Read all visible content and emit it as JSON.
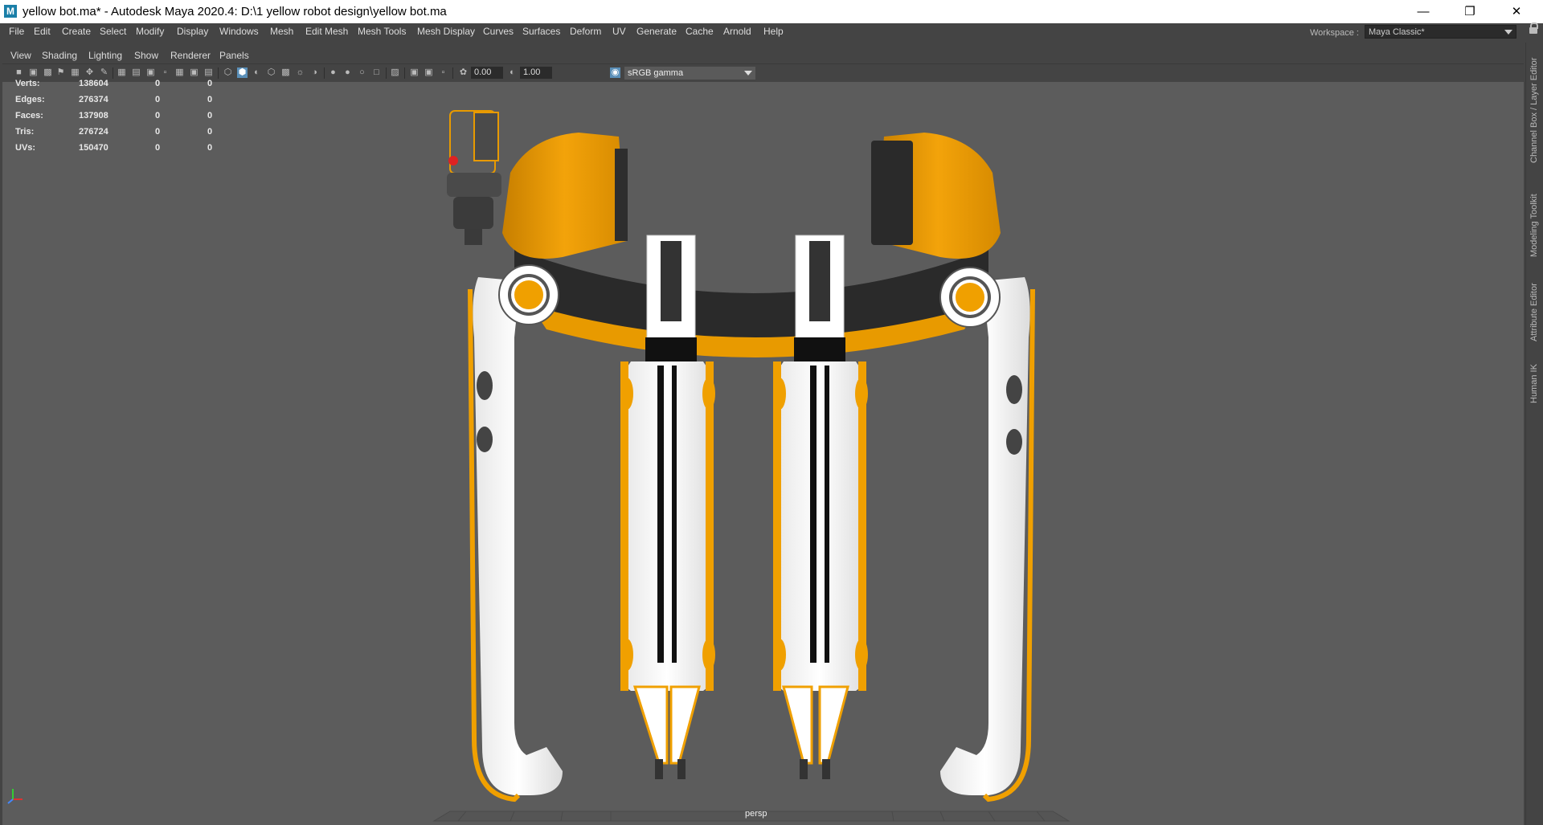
{
  "window": {
    "app_icon": "M",
    "title": "yellow bot.ma* - Autodesk Maya 2020.4: D:\\1 yellow robot design\\yellow bot.ma",
    "controls": [
      "minimize-icon",
      "restore-icon",
      "close-icon"
    ]
  },
  "menubar": {
    "items": [
      "File",
      "Edit",
      "Create",
      "Select",
      "Modify",
      "Display",
      "Windows",
      "Mesh",
      "Edit Mesh",
      "Mesh Tools",
      "Mesh Display",
      "Curves",
      "Surfaces",
      "Deform",
      "UV",
      "Generate",
      "Cache",
      "Arnold",
      "Help"
    ]
  },
  "workspace": {
    "label": "Workspace :",
    "value": "Maya Classic*"
  },
  "right_tabs": [
    "Channel Box / Layer Editor",
    "Modeling Toolkit",
    "Attribute Editor",
    "Human IK"
  ],
  "panel_menu": {
    "items": [
      "View",
      "Shading",
      "Lighting",
      "Show",
      "Renderer",
      "Panels"
    ]
  },
  "toolbar": {
    "exposure": "0.00",
    "gamma": "1.00",
    "color_space": "sRGB gamma"
  },
  "hud": {
    "rows": [
      {
        "label": "Verts:",
        "total": "138604",
        "selected": "0",
        "component": "0"
      },
      {
        "label": "Edges:",
        "total": "276374",
        "selected": "0",
        "component": "0"
      },
      {
        "label": "Faces:",
        "total": "137908",
        "selected": "0",
        "component": "0"
      },
      {
        "label": "Tris:",
        "total": "276724",
        "selected": "0",
        "component": "0"
      },
      {
        "label": "UVs:",
        "total": "150470",
        "selected": "0",
        "component": "0"
      }
    ]
  },
  "viewport": {
    "camera": "persp",
    "background": "#5c5c5c"
  },
  "colors": {
    "robot_yellow": "#f0a000",
    "robot_white": "#ffffff",
    "robot_dark": "#2a2a2a",
    "accent": "#1b7fa8"
  }
}
